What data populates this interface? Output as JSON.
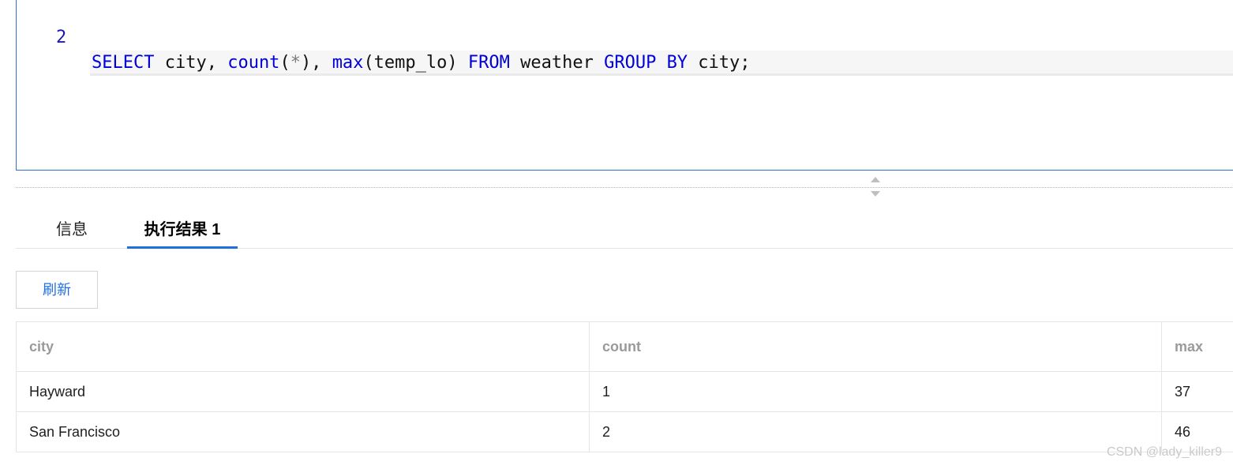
{
  "editor": {
    "line_number": "2",
    "tokens": {
      "select": "SELECT",
      "city1": " city, ",
      "count_fn": "count",
      "paren_open1": "(",
      "star": "*",
      "paren_close1": "), ",
      "max_fn": "max",
      "max_arg": "(temp_lo) ",
      "from": "FROM",
      "table": " weather ",
      "group_by": "GROUP BY",
      "city2": " city;"
    }
  },
  "tabs": [
    {
      "label": "信息"
    },
    {
      "label": "执行结果 1"
    }
  ],
  "toolbar": {
    "refresh_label": "刷新"
  },
  "result_table": {
    "columns": [
      "city",
      "count",
      "max"
    ],
    "rows": [
      [
        "Hayward",
        "1",
        "37"
      ],
      [
        "San Francisco",
        "2",
        "46"
      ]
    ]
  },
  "watermark": "CSDN @lady_killer9"
}
